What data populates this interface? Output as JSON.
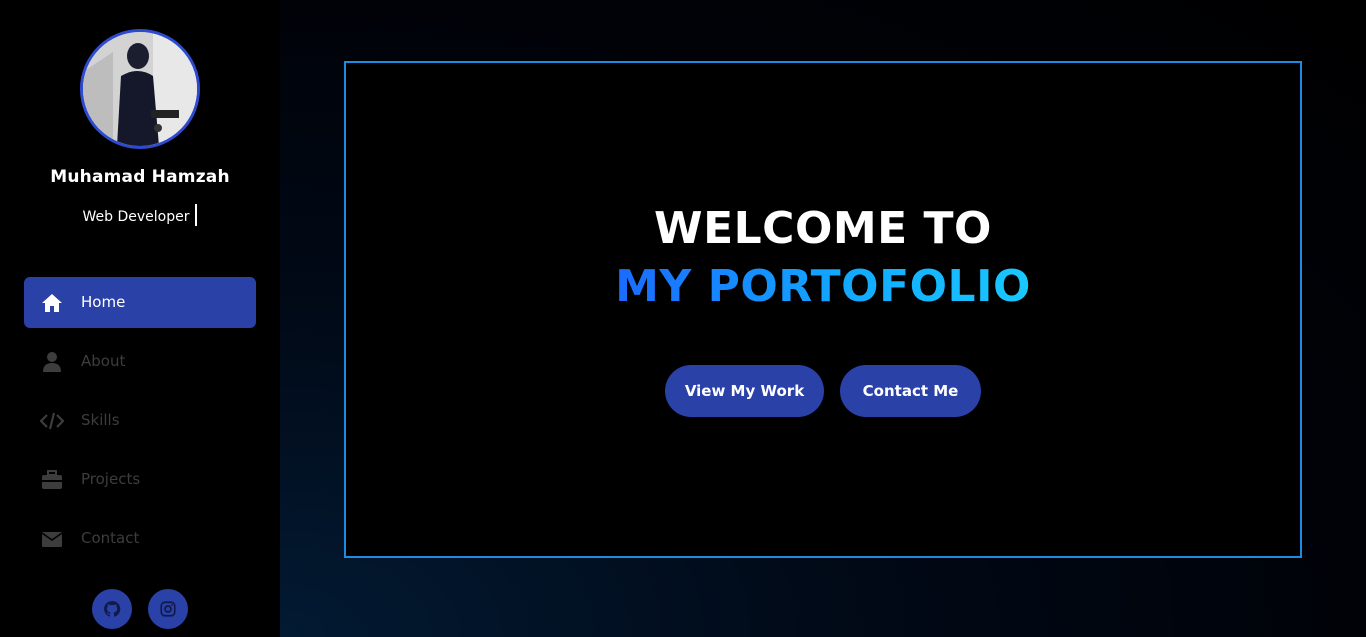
{
  "profile": {
    "name": "Muhamad Hamzah",
    "role": "Web Developer",
    "avatar_icon": "profile-photo"
  },
  "nav": {
    "items": [
      {
        "label": "Home",
        "icon": "home-icon",
        "active": true
      },
      {
        "label": "About",
        "icon": "user-icon",
        "active": false
      },
      {
        "label": "Skills",
        "icon": "code-icon",
        "active": false
      },
      {
        "label": "Projects",
        "icon": "briefcase-icon",
        "active": false
      },
      {
        "label": "Contact",
        "icon": "envelope-icon",
        "active": false
      }
    ]
  },
  "socials": [
    {
      "icon": "github-icon"
    },
    {
      "icon": "instagram-icon"
    }
  ],
  "hero": {
    "line1": "WELCOME TO",
    "line2": "MY PORTOFOLIO",
    "primary_button": "View My Work",
    "secondary_button": "Contact Me"
  },
  "colors": {
    "accent": "#2a41a8",
    "hero_border": "#1f8be0",
    "gradient_start": "#1a6bff",
    "gradient_end": "#19c9ff",
    "nav_inactive": "#3d3d3d"
  }
}
